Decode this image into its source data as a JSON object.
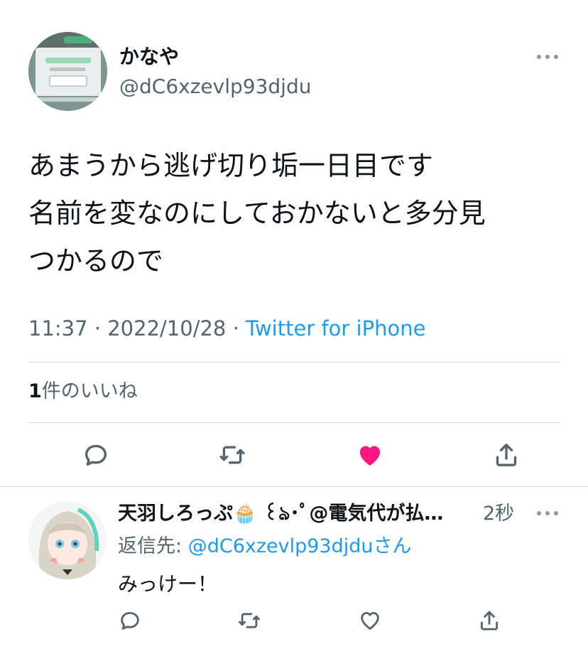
{
  "tweet": {
    "display_name": "かなや",
    "handle": "@dC6xzevlp93djdu",
    "text_lines": [
      "あまうから逃げ切り垢一日目です",
      "名前を変なのにしておかないと多分見",
      "つかるので"
    ],
    "time": "11:37",
    "separator": " · ",
    "date": "2022/10/28",
    "source": "Twitter for iPhone",
    "like_count": "1",
    "like_label": "件のいいね",
    "liked": true,
    "colors": {
      "like": "#f91880",
      "link": "#1d9bf0",
      "muted": "#536471"
    }
  },
  "reply": {
    "display_name": "天羽しろっぷ🧁 ꒰ঌ･ﾟ@電気代が払…",
    "time": "2秒",
    "reply_to_label": "返信先:",
    "reply_to_handle": "@dC6xzevlp93djdu",
    "reply_to_suffix": "さん",
    "text": "みっけー！"
  },
  "icons": [
    "more-icon",
    "reply-icon",
    "retweet-icon",
    "like-icon",
    "share-icon"
  ]
}
